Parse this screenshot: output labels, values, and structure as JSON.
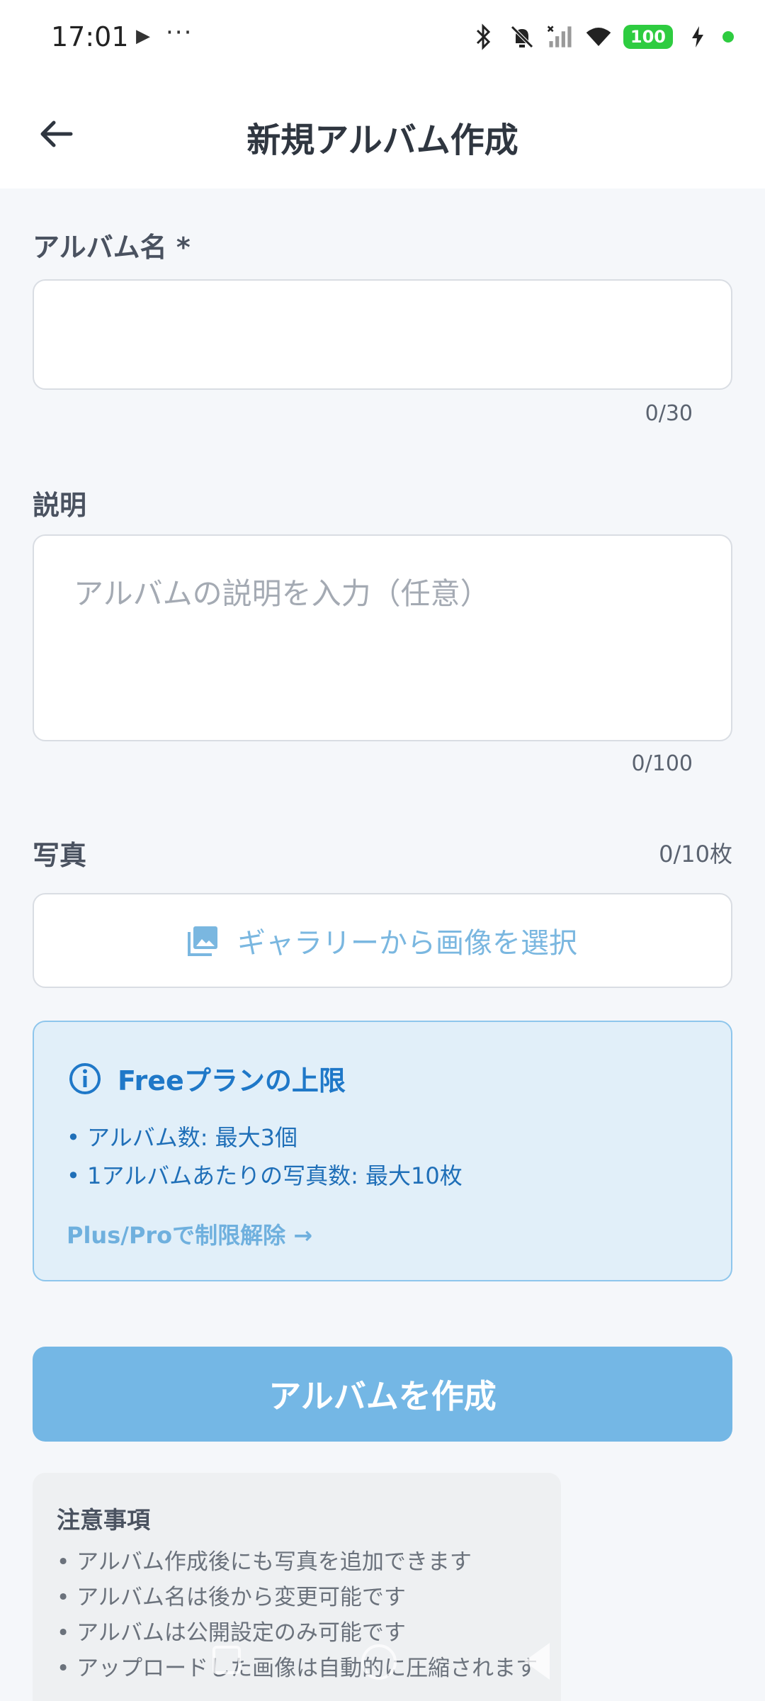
{
  "status_bar": {
    "time": "17:01",
    "more": "···",
    "battery": "100"
  },
  "app_bar": {
    "title": "新規アルバム作成"
  },
  "form": {
    "album_name": {
      "label": "アルバム名 *",
      "value": "",
      "counter": "0/30"
    },
    "description": {
      "label": "説明",
      "placeholder": "アルバムの説明を入力（任意）",
      "counter": "0/100"
    },
    "photos": {
      "label": "写真",
      "counter": "0/10枚",
      "gallery_button": "ギャラリーから画像を選択"
    }
  },
  "plan_info": {
    "title": "Freeプランの上限",
    "lines": [
      "• アルバム数: 最大3個",
      "• 1アルバムあたりの写真数: 最大10枚"
    ],
    "upgrade_link": "Plus/Proで制限解除 →"
  },
  "create_button": "アルバムを作成",
  "notes": {
    "title": "注意事項",
    "items": [
      "• アルバム作成後にも写真を追加できます",
      "• アルバム名は後から変更可能です",
      "• アルバムは公開設定のみ可能です",
      "• アップロードした画像は自動的に圧縮されます"
    ]
  },
  "colors": {
    "accent": "#1f78c8",
    "button": "#74b7e5",
    "info_bg": "#e1eff9"
  }
}
